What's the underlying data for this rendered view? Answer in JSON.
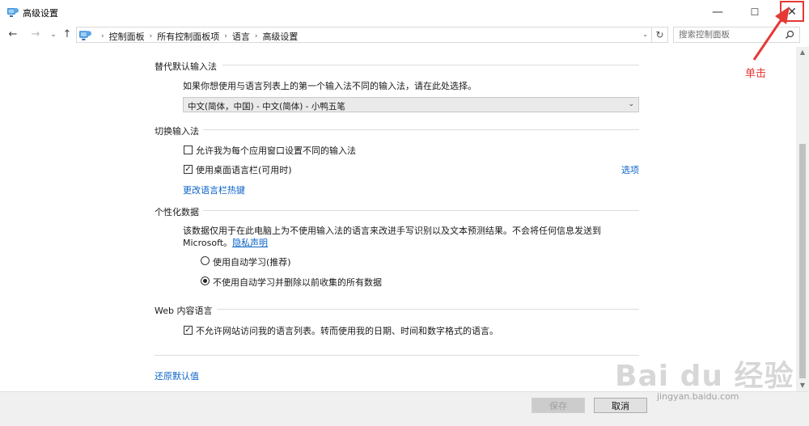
{
  "window": {
    "title": "高级设置",
    "minimize": "—",
    "maximize": "☐",
    "close": "✕"
  },
  "nav": {
    "back": "←",
    "forward": "→",
    "recent": "⌄",
    "up": "↑",
    "breadcrumbs": [
      "控制面板",
      "所有控制面板项",
      "语言",
      "高级设置"
    ],
    "separator": "›",
    "dropdown": "⌄",
    "refresh": "↻",
    "search_placeholder": "搜索控制面板"
  },
  "sections": {
    "default_input": {
      "title": "替代默认输入法",
      "description": "如果你想使用与语言列表上的第一个输入法不同的输入法，请在此处选择。",
      "selected": "中文(简体，中国) - 中文(简体) - 小鸭五笔",
      "dropdown_arrow": "⌄"
    },
    "switch_input": {
      "title": "切换输入法",
      "option_per_app": "允许我为每个应用窗口设置不同的输入法",
      "option_per_app_checked": false,
      "option_langbar": "使用桌面语言栏(可用时)",
      "option_langbar_checked": true,
      "options_link": "选项",
      "hotkeys_link": "更改语言栏热键"
    },
    "personalization": {
      "title": "个性化数据",
      "description_line1": "该数据仅用于在此电脑上为不使用输入法的语言来改进手写识别以及文本预测结果。不会将任何信息发送到",
      "description_line2": "Microsoft。",
      "privacy_link": "隐私声明",
      "radio_auto": "使用自动学习(推荐)",
      "radio_no_auto": "不使用自动学习并删除以前收集的所有数据",
      "selected": "no_auto"
    },
    "web_content": {
      "title": "Web 内容语言",
      "option": "不允许网站访问我的语言列表。转而使用我的日期、时间和数字格式的语言。",
      "option_checked": true
    }
  },
  "restore_link": "还原默认值",
  "footer": {
    "save": "保存",
    "cancel": "取消"
  },
  "annotation": {
    "label": "单击",
    "color": "#e53935"
  },
  "watermark": {
    "brand": "Bai du 经验",
    "url": "jingyan.baidu.com"
  },
  "colors": {
    "link": "#0a63c9",
    "annotation": "#e53935"
  }
}
